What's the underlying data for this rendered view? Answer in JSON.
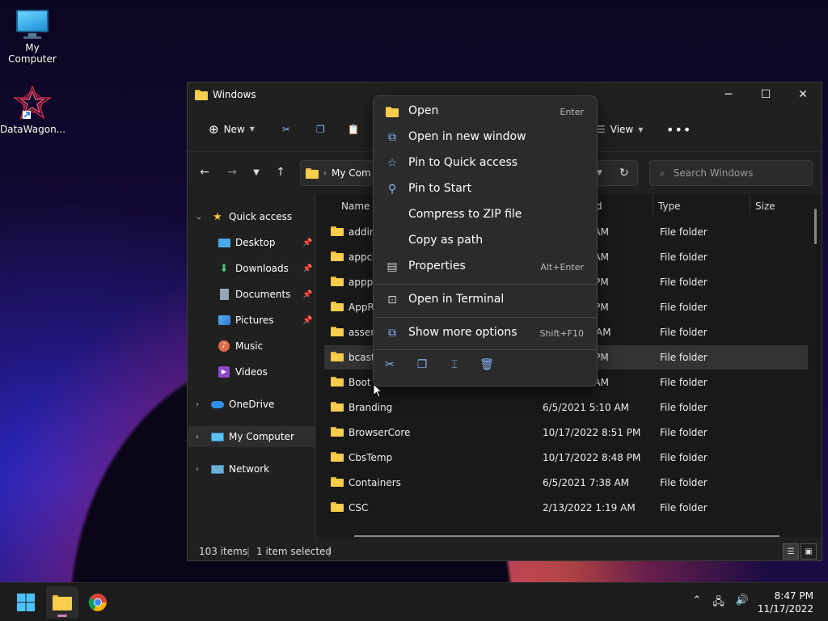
{
  "desktop": {
    "icons": [
      {
        "label": "My Computer"
      },
      {
        "label": "DataWagon..."
      }
    ]
  },
  "window": {
    "title": "Windows",
    "toolbar": {
      "new_label": "New",
      "view_label": "View"
    },
    "address": {
      "crumb": "My Com"
    },
    "search": {
      "placeholder": "Search Windows"
    },
    "sidebar": {
      "items": [
        {
          "label": "Quick access",
          "icon": "star-icon"
        },
        {
          "label": "Desktop",
          "icon": "desktop-icon",
          "pinned": true
        },
        {
          "label": "Downloads",
          "icon": "download-icon",
          "pinned": true
        },
        {
          "label": "Documents",
          "icon": "document-icon",
          "pinned": true
        },
        {
          "label": "Pictures",
          "icon": "pictures-icon",
          "pinned": true
        },
        {
          "label": "Music",
          "icon": "music-icon"
        },
        {
          "label": "Videos",
          "icon": "videos-icon"
        },
        {
          "label": "OneDrive",
          "icon": "cloud-icon"
        },
        {
          "label": "My Computer",
          "icon": "computer-icon"
        },
        {
          "label": "Network",
          "icon": "network-icon"
        }
      ]
    },
    "columns": {
      "name": "Name",
      "date_fragment": "d",
      "type": "Type",
      "size": "Size"
    },
    "files": [
      {
        "name": "addin",
        "date": "0 AM",
        "type": "File folder"
      },
      {
        "name": "appco",
        "date": "0 AM",
        "type": "File folder"
      },
      {
        "name": "apppa",
        "date": "51 PM",
        "type": "File folder"
      },
      {
        "name": "AppRe",
        "date": "46 PM",
        "type": "File folder"
      },
      {
        "name": "assem",
        "date": "AM",
        "type": "File folder"
      },
      {
        "name": "bcastc",
        "date": "51 PM",
        "type": "File folder"
      },
      {
        "name": "Boot",
        "date": "0 AM",
        "type": "File folder"
      },
      {
        "name": "Branding",
        "date": "6/5/2021 5:10 AM",
        "type": "File folder"
      },
      {
        "name": "BrowserCore",
        "date": "10/17/2022 8:51 PM",
        "type": "File folder"
      },
      {
        "name": "CbsTemp",
        "date": "10/17/2022 8:48 PM",
        "type": "File folder"
      },
      {
        "name": "Containers",
        "date": "6/5/2021 7:38 AM",
        "type": "File folder"
      },
      {
        "name": "CSC",
        "date": "2/13/2022 1:19 AM",
        "type": "File folder"
      }
    ],
    "status": {
      "items": "103 items",
      "selected": "1 item selected"
    }
  },
  "context_menu": {
    "items": [
      {
        "label": "Open",
        "shortcut": "Enter"
      },
      {
        "label": "Open in new window",
        "shortcut": ""
      },
      {
        "label": "Pin to Quick access",
        "shortcut": ""
      },
      {
        "label": "Pin to Start",
        "shortcut": ""
      },
      {
        "label": "Compress to ZIP file",
        "shortcut": ""
      },
      {
        "label": "Copy as path",
        "shortcut": ""
      },
      {
        "label": "Properties",
        "shortcut": "Alt+Enter"
      },
      {
        "label": "Open in Terminal",
        "shortcut": ""
      },
      {
        "label": "Show more options",
        "shortcut": "Shift+F10"
      }
    ]
  },
  "taskbar": {
    "time": "8:47 PM",
    "date": "11/17/2022"
  },
  "colors": {
    "accent": "#8ab4f8",
    "folder": "#f8cd4c",
    "taskbar": "#1c1c1c"
  }
}
